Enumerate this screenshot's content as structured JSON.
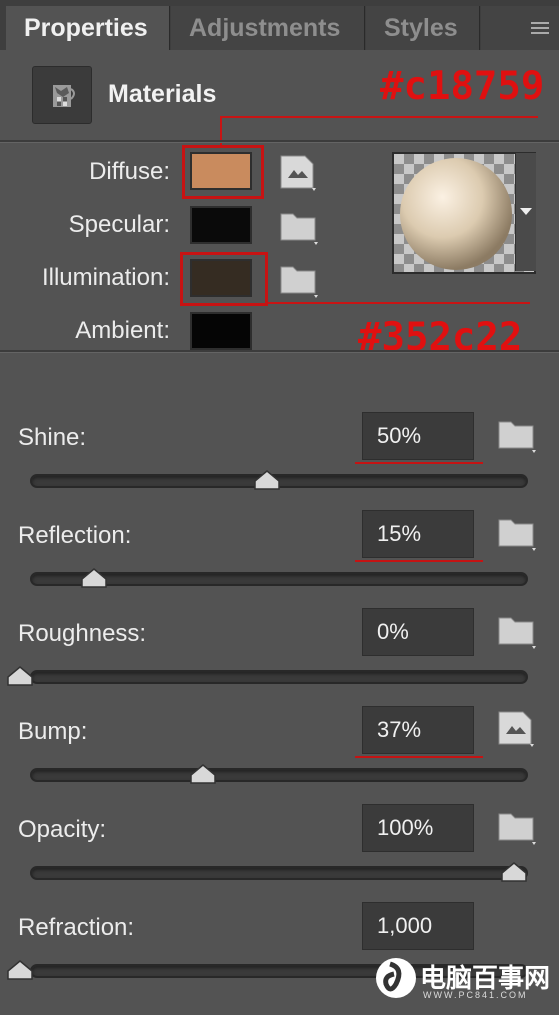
{
  "tabs": [
    {
      "label": "Properties",
      "active": true
    },
    {
      "label": "Adjustments",
      "active": false
    },
    {
      "label": "Styles",
      "active": false
    }
  ],
  "panel": {
    "title": "Materials",
    "icon": "materials-icon"
  },
  "annotations": {
    "diffuse_hex": "#c18759",
    "illumination_hex": "#352c22",
    "color": "#e01010"
  },
  "colors": {
    "diffuse": {
      "label": "Diffuse:",
      "color": "#c98b5e"
    },
    "specular": {
      "label": "Specular:",
      "color": "#0a0a0a"
    },
    "illumination": {
      "label": "Illumination:",
      "color": "#352c22"
    },
    "ambient": {
      "label": "Ambient:",
      "color": "#050505"
    }
  },
  "sliders": [
    {
      "label": "Shine:",
      "value": "50%",
      "fraction": 0.5,
      "underline": true,
      "icon": "folder-icon"
    },
    {
      "label": "Reflection:",
      "value": "15%",
      "fraction": 0.15,
      "underline": true,
      "icon": "folder-icon"
    },
    {
      "label": "Roughness:",
      "value": "0%",
      "fraction": 0.0,
      "underline": false,
      "icon": "folder-icon"
    },
    {
      "label": "Bump:",
      "value": "37%",
      "fraction": 0.37,
      "underline": true,
      "icon": "texture-icon"
    },
    {
      "label": "Opacity:",
      "value": "100%",
      "fraction": 1.0,
      "underline": false,
      "icon": "folder-icon"
    },
    {
      "label": "Refraction:",
      "value": "1,000",
      "fraction": 0.0,
      "underline": false,
      "icon": ""
    }
  ],
  "watermark": {
    "name": "电脑百事网",
    "url": "WWW.PC841.COM"
  }
}
